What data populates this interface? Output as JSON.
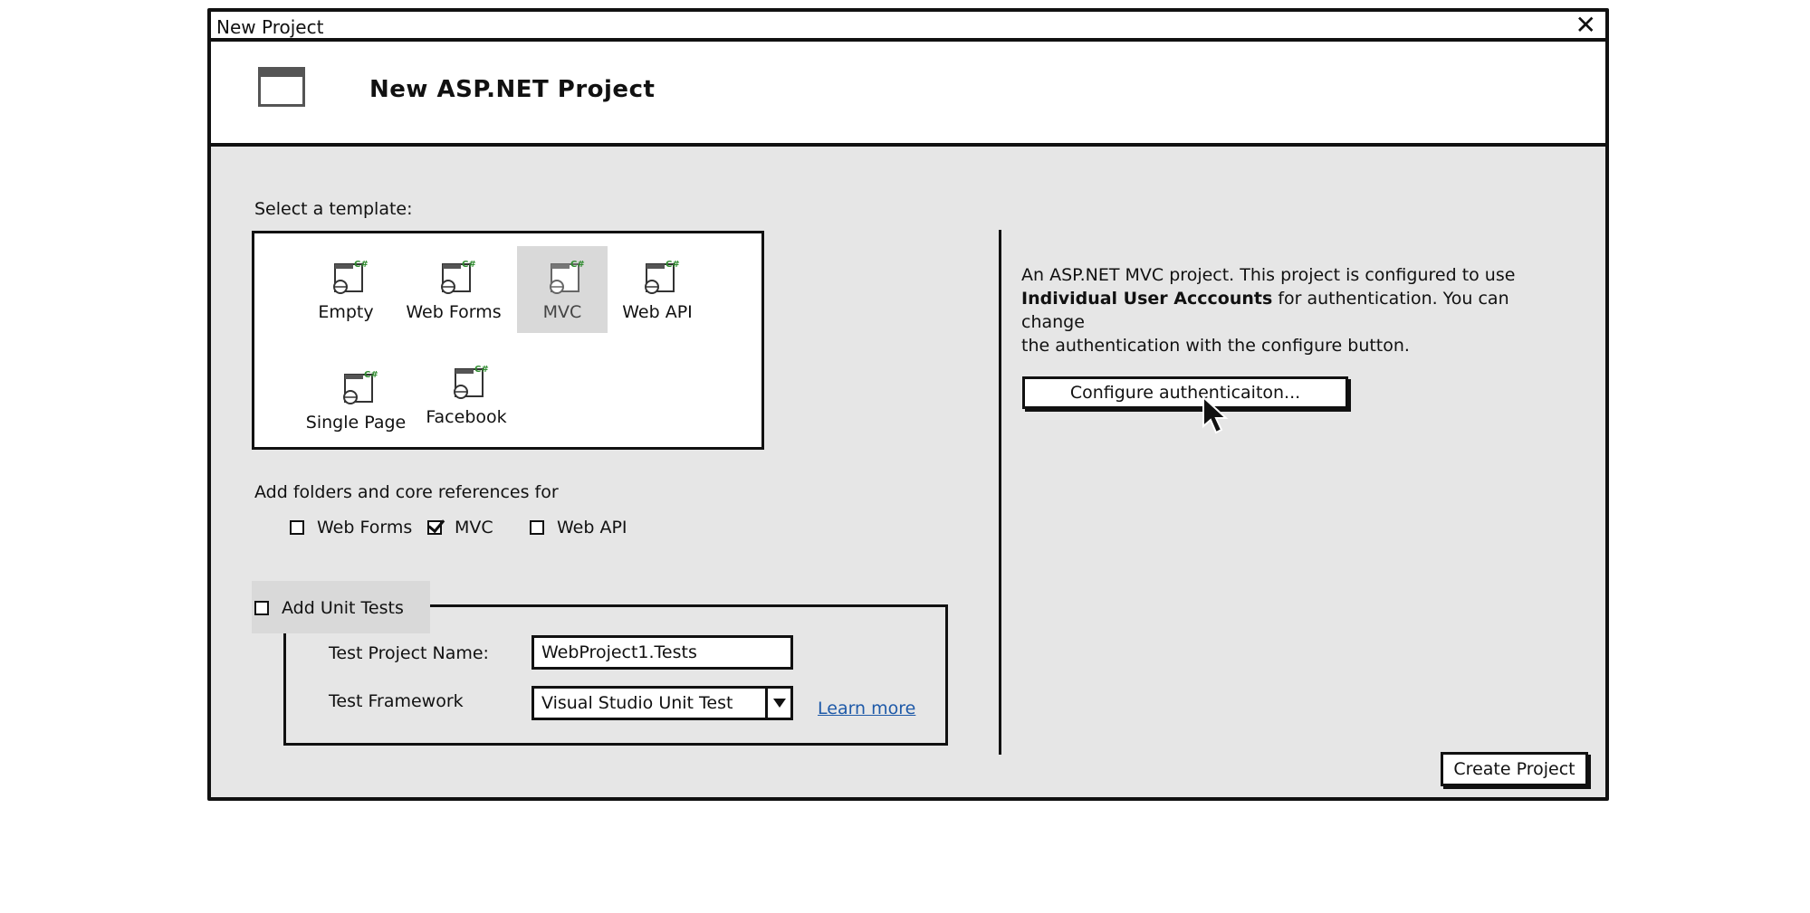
{
  "window": {
    "title": "New Project"
  },
  "header": {
    "title": "New ASP.NET Project"
  },
  "templates": {
    "label": "Select a template:",
    "items": [
      {
        "label": "Empty"
      },
      {
        "label": "Web Forms"
      },
      {
        "label": "MVC",
        "selected": true
      },
      {
        "label": "Web API"
      },
      {
        "label": "Single Page"
      },
      {
        "label": "Facebook"
      }
    ]
  },
  "folders": {
    "label": "Add folders and core references for",
    "options": [
      {
        "label": "Web Forms",
        "checked": false
      },
      {
        "label": "MVC",
        "checked": true
      },
      {
        "label": "Web API",
        "checked": false
      }
    ]
  },
  "unit_tests": {
    "label": "Add Unit Tests",
    "checked": false,
    "project_name_label": "Test Project Name:",
    "project_name_value": "WebProject1.Tests",
    "framework_label": "Test Framework",
    "framework_value": "Visual Studio Unit Test",
    "learn_more": "Learn more"
  },
  "description": {
    "line1": "An ASP.NET MVC project. This project is configured to use",
    "bold": "Individual User Acccounts",
    "line2_rest": " for authentication. You can change",
    "line3": "the authentication with the configure button."
  },
  "buttons": {
    "configure": "Configure authenticaiton...",
    "create": "Create Project"
  },
  "colors": {
    "panel": "#e6e6e6",
    "selected": "#d9d9d9",
    "csharp_badge": "#2e8b2e",
    "link": "#1f5aa8"
  }
}
